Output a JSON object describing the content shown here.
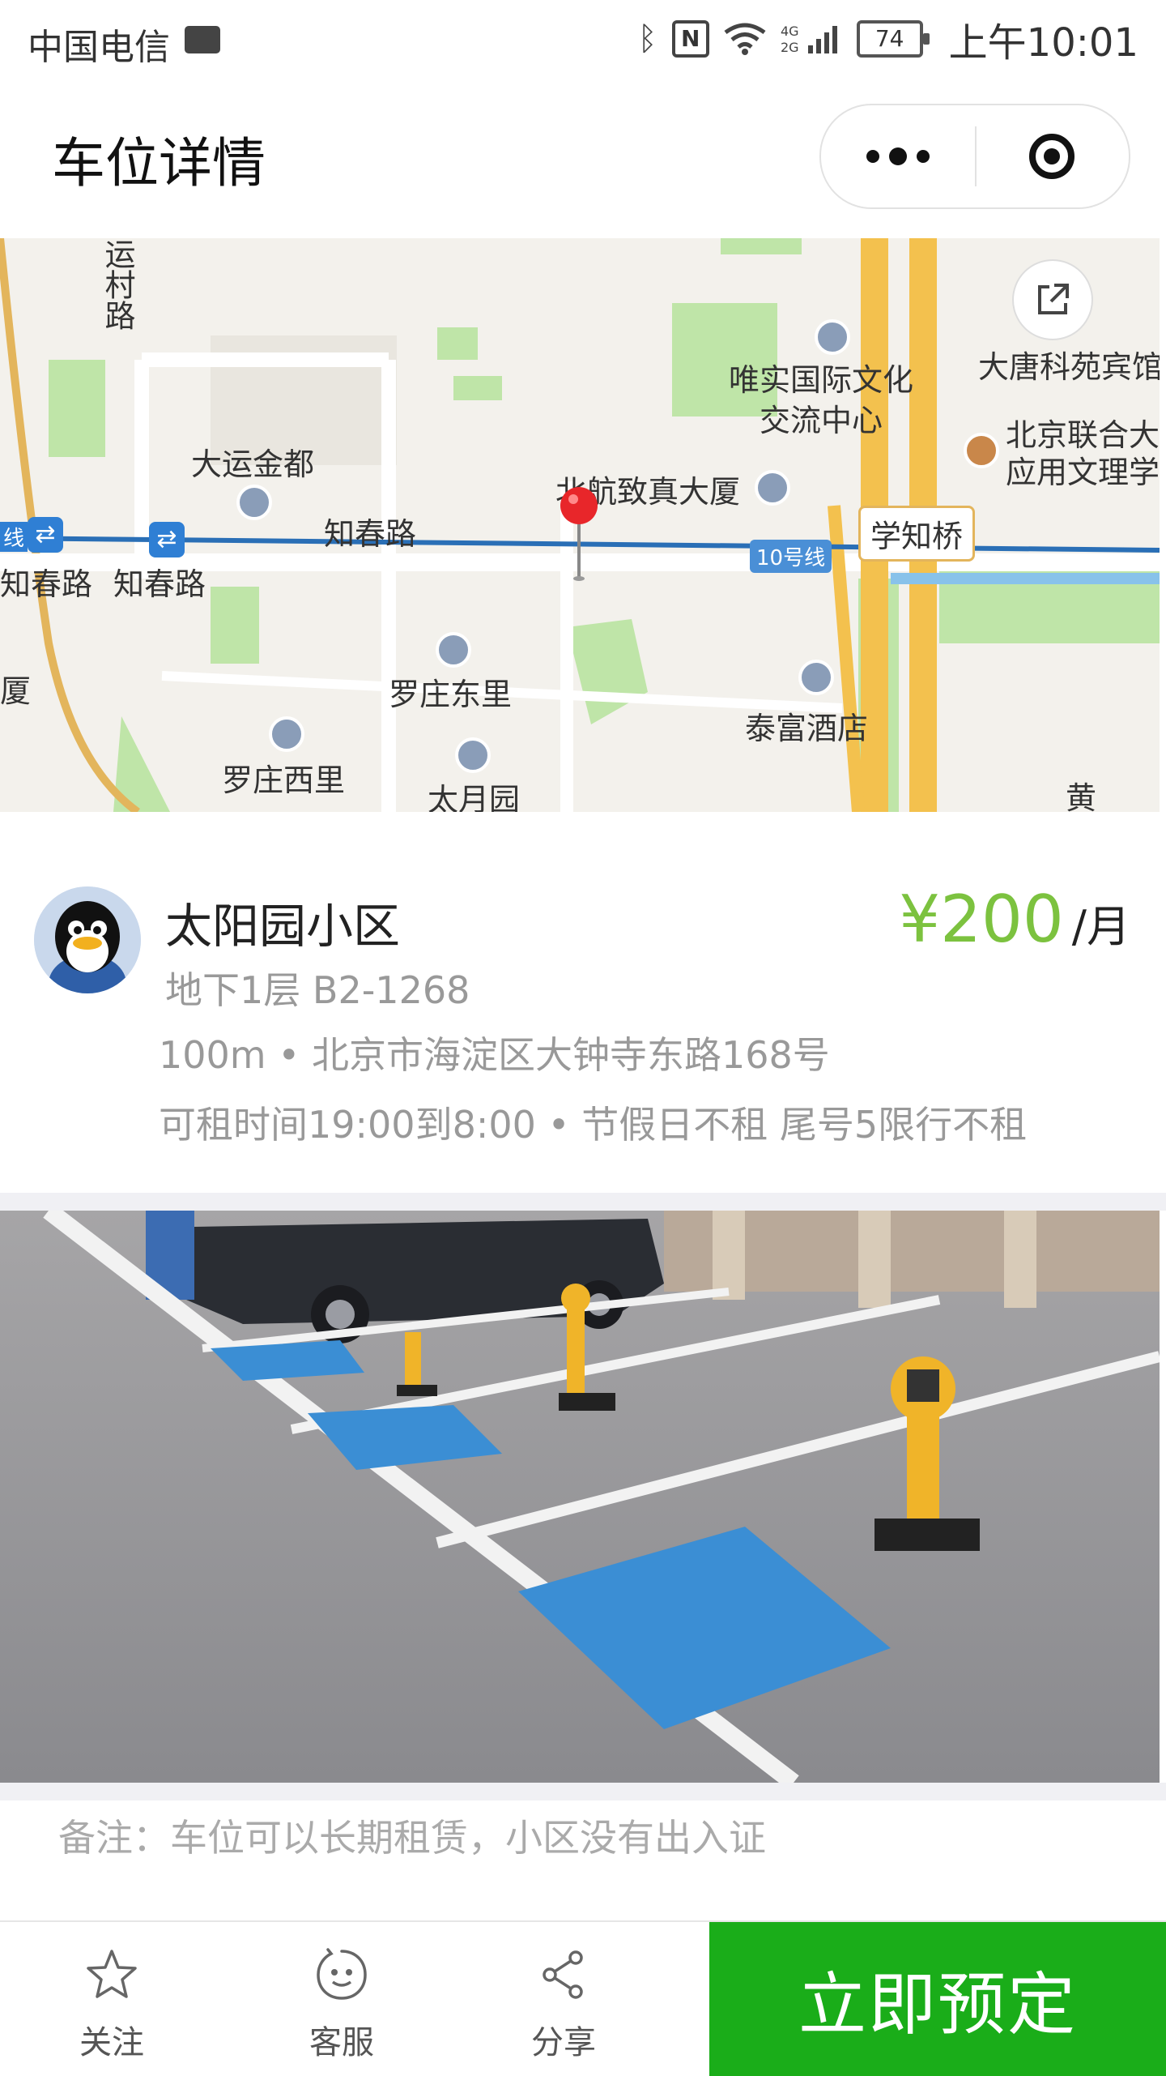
{
  "status_bar": {
    "carrier": "中国电信",
    "battery": "74",
    "time": "上午10:01"
  },
  "nav": {
    "title": "车位详情"
  },
  "map": {
    "labels": {
      "yuncun_road": "运村路",
      "dayun_jindu": "大运金都",
      "weishi_center": "唯实国际文化\n交流中心",
      "datang_hotel": "大唐科苑宾馆",
      "lianhe_univ": "北京联合大学\n应用文理学院",
      "beihang_building": "北航致真大厦",
      "zhichun_road": "知春路",
      "zhichun_station_1": "知春路",
      "zhichun_station_2": "知春路",
      "line_10": "10号线",
      "xuezhi_bridge": "学知桥",
      "luozhuang_east": "罗庄东里",
      "luozhuang_west": "罗庄西里",
      "taiyue_garden": "太月园",
      "taifu_hotel": "泰富酒店",
      "edge_sha": "厦",
      "edge_line": "线",
      "edge_huang": "黄"
    }
  },
  "lot": {
    "name": "太阳园小区",
    "floor": "地下1层 B2-1268",
    "address": "100m • 北京市海淀区大钟寺东路168号",
    "rent_time": "可租时间19:00到8:00 • 节假日不租 尾号5限行不租",
    "price": "¥200",
    "price_unit": "/月"
  },
  "remark": "备注：车位可以长期租赁，小区没有出入证",
  "bottom": {
    "follow": "关注",
    "service": "客服",
    "share": "分享",
    "book": "立即预定"
  },
  "colors": {
    "price_green": "#7cc23f",
    "book_green": "#1aad19",
    "pin_red": "#e8262a",
    "metro_blue": "#2f7fd4"
  }
}
